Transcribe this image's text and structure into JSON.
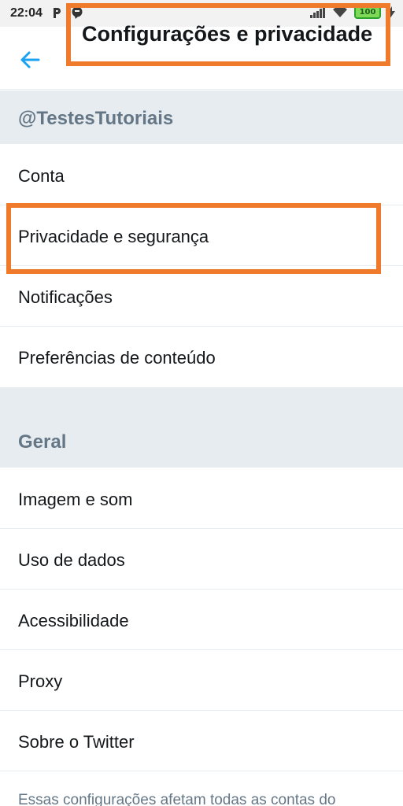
{
  "status_bar": {
    "time": "22:04",
    "battery": "100"
  },
  "header": {
    "title": "Configurações e privacidade",
    "back_icon": "arrow-left-icon",
    "accent_color": "#1da1f2",
    "highlight_color": "#f07a2c"
  },
  "account_section": {
    "title": "@TestesTutoriais",
    "items": [
      {
        "label": "Conta"
      },
      {
        "label": "Privacidade e segurança"
      },
      {
        "label": "Notificações"
      },
      {
        "label": "Preferências de conteúdo"
      }
    ]
  },
  "general_section": {
    "title": "Geral",
    "items": [
      {
        "label": "Imagem e som"
      },
      {
        "label": "Uso de dados"
      },
      {
        "label": "Acessibilidade"
      },
      {
        "label": "Proxy"
      },
      {
        "label": "Sobre o Twitter"
      }
    ]
  },
  "footer": {
    "note": "Essas configurações afetam todas as contas do"
  }
}
